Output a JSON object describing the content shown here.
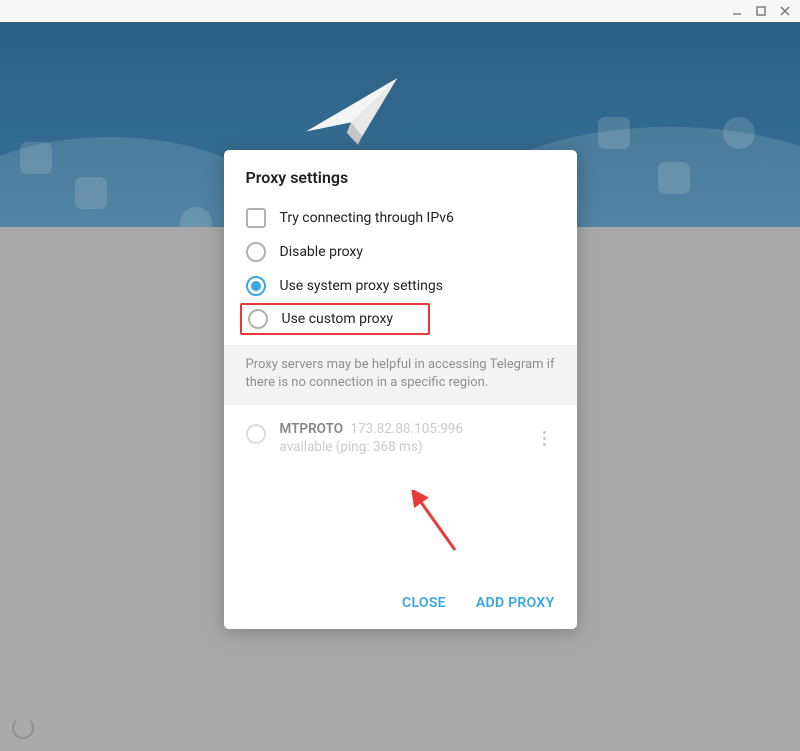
{
  "dialog": {
    "title": "Proxy settings",
    "options": {
      "ipv6": "Try connecting through IPv6",
      "disable": "Disable proxy",
      "system": "Use system proxy settings",
      "custom": "Use custom proxy"
    },
    "info_text": "Proxy servers may be helpful in accessing Telegram if there is no connection in a specific region.",
    "proxy": {
      "protocol": "MTPROTO",
      "address": "173.82.88.105:996",
      "status": "available (ping: 368 ms)"
    },
    "footer": {
      "close": "CLOSE",
      "add": "ADD PROXY"
    }
  }
}
